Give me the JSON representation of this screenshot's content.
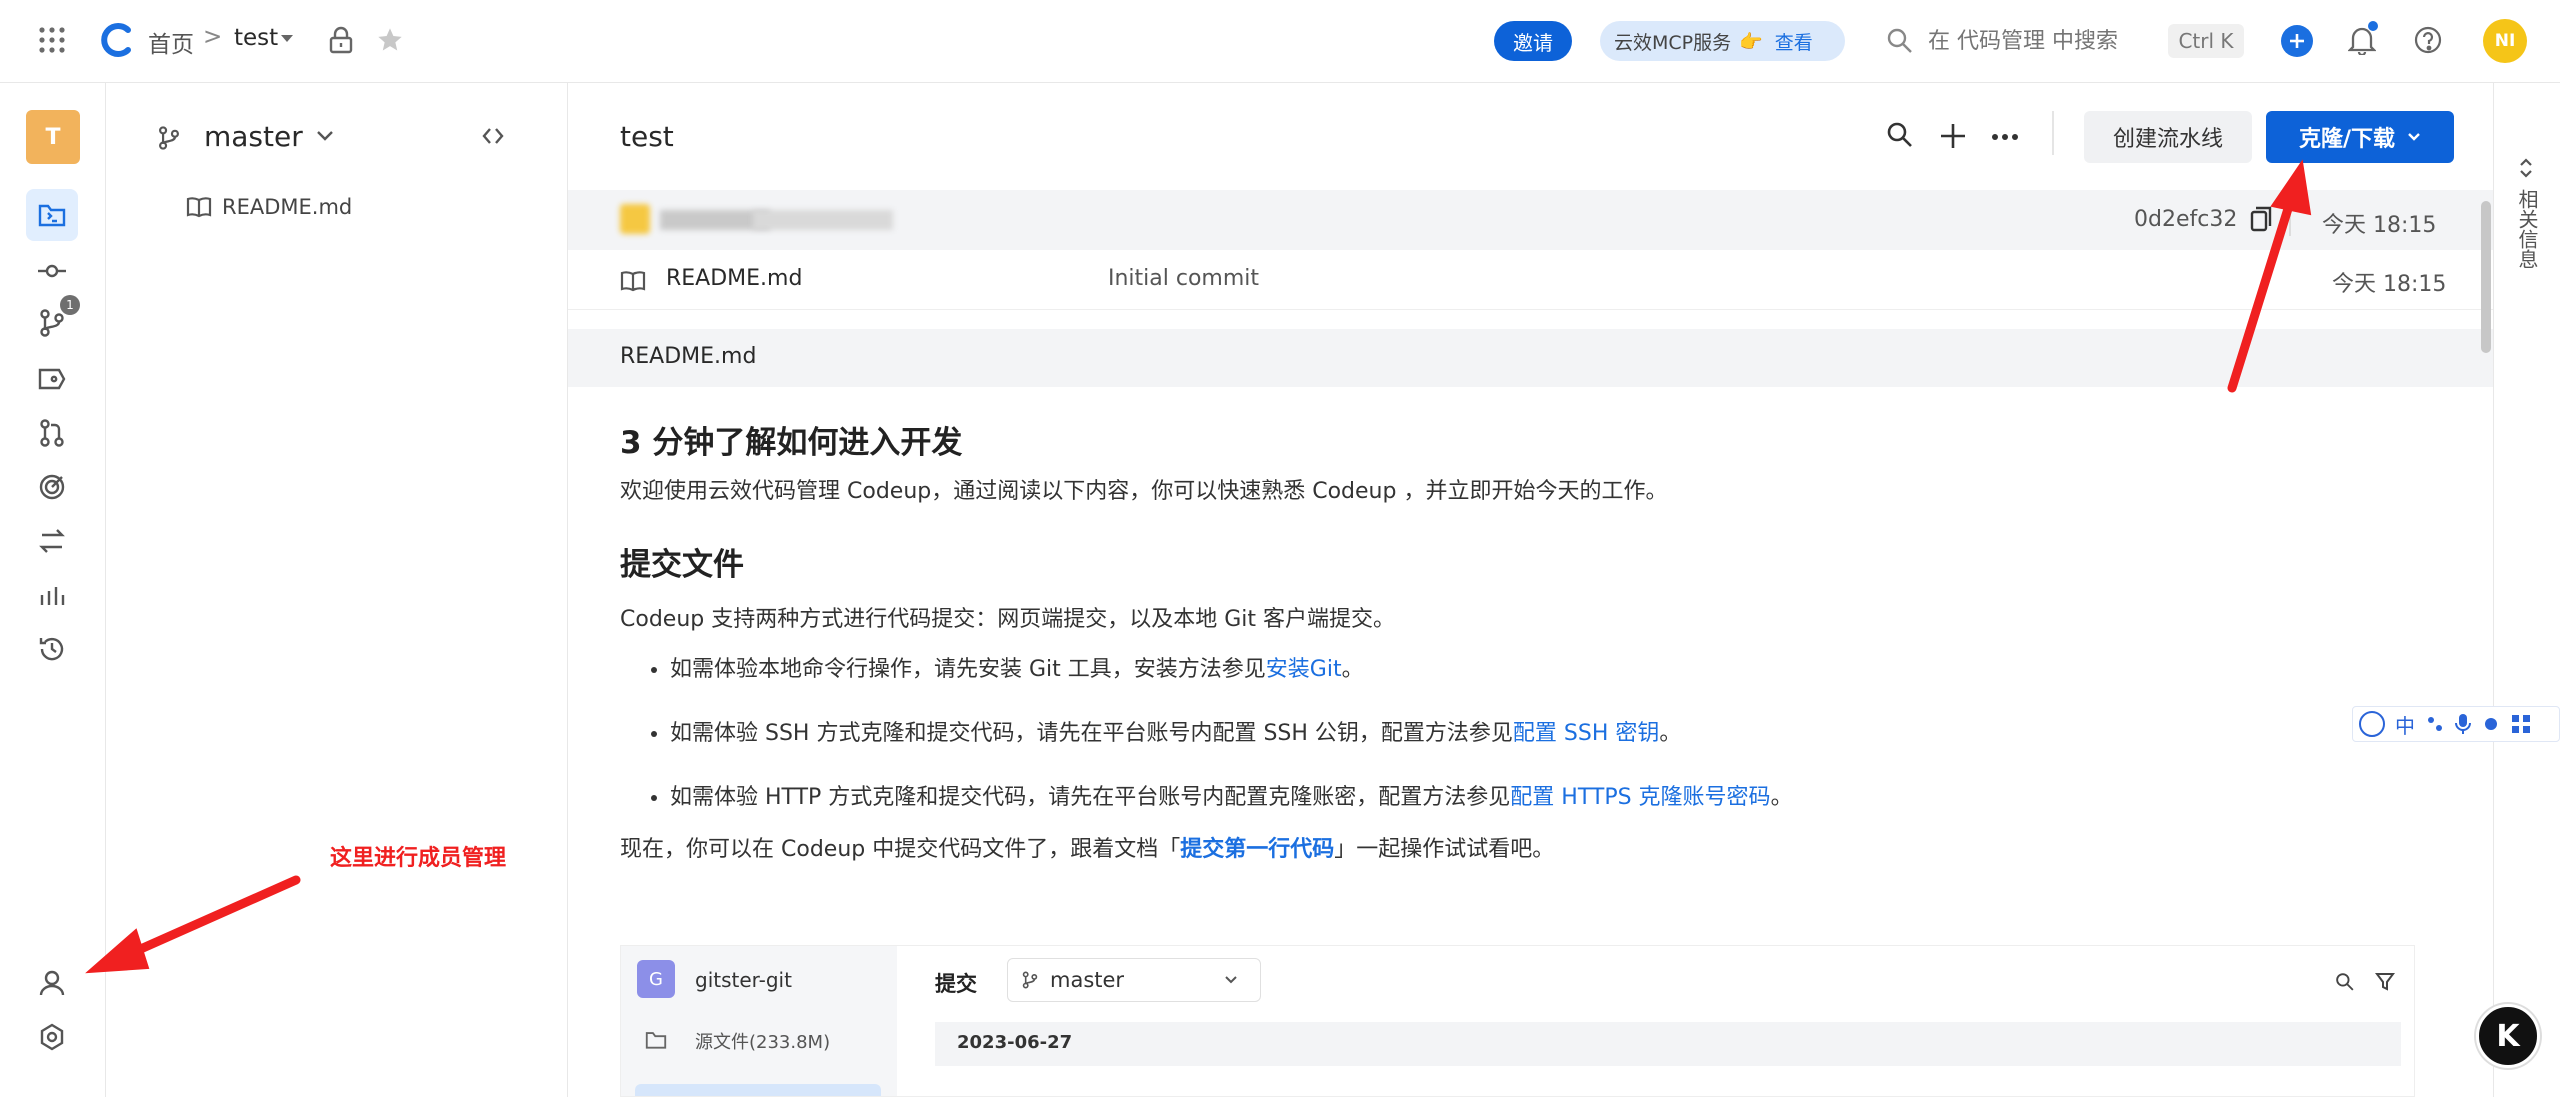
{
  "topbar": {
    "home": "首页",
    "sep": ">",
    "repo": "test",
    "invite": "邀请",
    "mcp_label": "云效MCP服务",
    "mcp_emoji": "👉",
    "mcp_view": "查看",
    "search_placeholder": "在 代码管理 中搜索",
    "shortcut": "Ctrl K",
    "avatar": "NI"
  },
  "rail": {
    "avatar": "T",
    "branch_badge": "1"
  },
  "tree": {
    "branch": "master",
    "files": [
      "README.md"
    ]
  },
  "main": {
    "title": "test",
    "create_pipeline": "创建流水线",
    "clone_download": "克隆/下载",
    "commit_hash": "0d2efc32",
    "commit_time": "今天 18:15",
    "file_row": {
      "name": "README.md",
      "message": "Initial commit",
      "time": "今天 18:15"
    },
    "readme_header": "README.md"
  },
  "doc": {
    "h1": "3 分钟了解如何进入开发",
    "p1": "欢迎使用云效代码管理 Codeup，通过阅读以下内容，你可以快速熟悉 Codeup ，并立即开始今天的工作。",
    "h2": "提交文件",
    "p2": "Codeup 支持两种方式进行代码提交：网页端提交，以及本地 Git 客户端提交。",
    "li1_text": "如需体验本地命令行操作，请先安装 Git 工具，安装方法参见",
    "li1_link": "安装Git",
    "li1_end": "。",
    "li2_text": "如需体验 SSH 方式克隆和提交代码，请先在平台账号内配置 SSH 公钥，配置方法参见",
    "li2_link": "配置 SSH 密钥",
    "li2_end": "。",
    "li3_text": "如需体验 HTTP 方式克隆和提交代码，请先在平台账号内配置克隆账密，配置方法参见",
    "li3_link": "配置 HTTPS 克隆账号密码",
    "li3_end": "。",
    "p3_a": "现在，你可以在 Codeup 中提交代码文件了，跟着文档「",
    "p3_link": "提交第一行代码",
    "p3_b": "」一起操作试试看吧。"
  },
  "embedded": {
    "repo_avatar": "G",
    "repo_name": "gitster-git",
    "source_files": "源文件(233.8M)",
    "commit_tab": "提交",
    "branch": "master",
    "date": "2023-06-27"
  },
  "right_panel": {
    "label": "相关信息"
  },
  "ime": {
    "zh": "中"
  },
  "annotation": {
    "member_mgmt": "这里进行成员管理"
  },
  "colors": {
    "primary": "#1b6fe0",
    "accent_red": "#f02020",
    "invite": "#0d62d8"
  }
}
